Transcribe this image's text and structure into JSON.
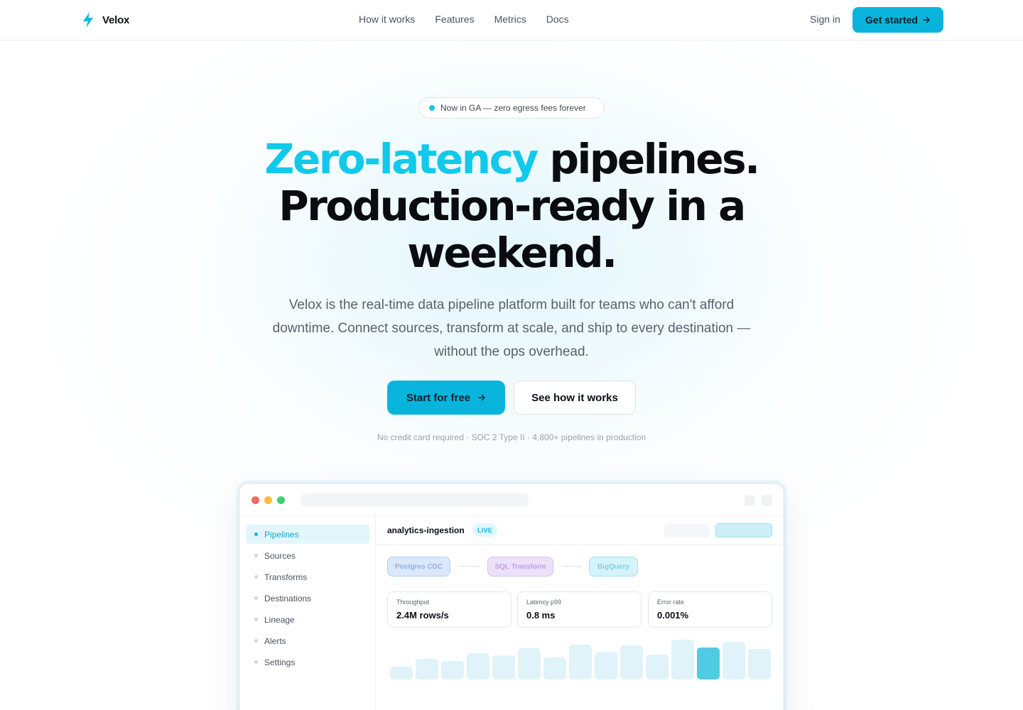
{
  "nav": {
    "brand": "Velox",
    "links": [
      "How it works",
      "Features",
      "Metrics",
      "Docs"
    ],
    "sign_in": "Sign in",
    "get_started": "Get started"
  },
  "hero": {
    "badge": "Now in GA — zero egress fees forever",
    "headline_accent": "Zero-latency",
    "headline_rest_line1": " pipelines.",
    "headline_line2": "Production-ready in a weekend.",
    "subheadline": "Velox is the real-time data pipeline platform built for teams who can't afford downtime. Connect sources, transform at scale, and ship to every destination — without the ops overhead.",
    "primary_cta": "Start for free",
    "secondary_cta": "See how it works",
    "fineprint": "No credit card required · SOC 2 Type II · 4,800+ pipelines in production"
  },
  "app": {
    "sidebar": [
      "Pipelines",
      "Sources",
      "Transforms",
      "Destinations",
      "Lineage",
      "Alerts",
      "Settings"
    ],
    "active_item": "Pipelines",
    "pipeline_name": "analytics-ingestion",
    "status": "LIVE",
    "flow": {
      "source": "Postgres CDC",
      "transform": "SQL Transform",
      "destination": "BigQuery"
    },
    "metrics": [
      {
        "label": "Throughput",
        "value": "2.4M rows/s"
      },
      {
        "label": "Latency p99",
        "value": "0.8 ms"
      },
      {
        "label": "Error rate",
        "value": "0.001%"
      }
    ],
    "chart_levels": [
      0.33,
      0.52,
      0.47,
      0.66,
      0.6,
      0.78,
      0.55,
      0.87,
      0.7,
      0.85,
      0.62,
      1.0,
      0.8,
      0.95,
      0.76
    ],
    "highlighted_bar_index": 12
  },
  "colors": {
    "accent": "#08b4dc",
    "headline_accent": "#11c9ea",
    "live": "#0fb8de"
  }
}
